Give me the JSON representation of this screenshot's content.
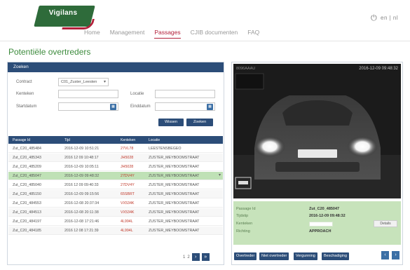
{
  "brand": {
    "logo_text": "Vigilans"
  },
  "header": {
    "lang_switch": "en | nl"
  },
  "nav": {
    "items": [
      "Home",
      "Management",
      "Passages",
      "CJIB documenten",
      "FAQ"
    ],
    "active": "Passages"
  },
  "page": {
    "title": "Potentiële overtreders"
  },
  "search": {
    "panel_title": "Zoeken",
    "contract_label": "Contract",
    "contract_value": "C01_Zuster_Leesten",
    "kenteken_label": "Kenteken",
    "locatie_label": "Locatie",
    "startdatum_label": "Startdatum",
    "einddatum_label": "Einddatum",
    "wissen_label": "Wissen",
    "zoeken_label": "Zoeken"
  },
  "table": {
    "headers": [
      "Passage Id",
      "Tijd",
      "Kenteken",
      "Locatie"
    ],
    "rows": [
      [
        "Zut_C20_485484",
        "2016-12-09 10:51:21",
        "27VL78",
        "LEESTENSBEGEO"
      ],
      [
        "Zut_C20_485343",
        "2016 12 09 10:48:17",
        "JH5028",
        "ZUSTER_MEYBOOMSTRAAT"
      ],
      [
        "Zut_C20_485209",
        "2016-12-09 10:05:11",
        "JH5028",
        "ZUSTER_MEYBOOMSTRAAT"
      ],
      [
        "Zut_C20_485047",
        "2016-12-09 09:48:32",
        "27DV4Y",
        "ZUSTER_MEYBOOMSTRAAT"
      ],
      [
        "Zut_C20_485040",
        "2016 12 09 09:40:33",
        "27DV4Y",
        "ZUSTER_MEYBOOMSTRAAT"
      ],
      [
        "Zut_C20_485150",
        "2016-12-09 09:15:56",
        "65SBRT",
        "ZUSTER_MEYBOOMSTRAAT"
      ],
      [
        "Zut_C20_484553",
        "2016-12-08 20:37:34",
        "VX534K",
        "ZUSTER_MEYBOOMSTRAAT"
      ],
      [
        "Zut_C20_484513",
        "2016-12-08 20:11:38",
        "VX534K",
        "ZUSTER_MEYBOOMSTRAAT"
      ],
      [
        "Zut_C20_484197",
        "2016-12-08 17:21:46",
        "4L994L",
        "ZUSTER_MEYBOOMSTRAAT"
      ],
      [
        "Zut_C20_484185",
        "2016 12 08 17:21:39",
        "4L994L",
        "ZUSTER_MEYBOOMSTRAAT"
      ]
    ],
    "selected_row": 3
  },
  "pager": {
    "pages": [
      "1",
      "2"
    ],
    "next": "›",
    "last": "»"
  },
  "detail": {
    "camera_id": "8096AAAU",
    "timestamp": "2016-12-09 09:48:32",
    "passage_id_label": "Passage Id",
    "passage_id_value": "Zut_C20_485047",
    "tijdstip_label": "Tijdstip",
    "tijdstip_value": "2016-12-09 09:48:32",
    "kenteken_label": "Kenteken",
    "richting_label": "Richting",
    "richting_value": "APPROACH",
    "details_label": "Details",
    "buttons": [
      "Overtreder",
      "Niet overtreder",
      "Vergunning",
      "Beschadiging"
    ],
    "prev": "‹",
    "next": "›"
  }
}
